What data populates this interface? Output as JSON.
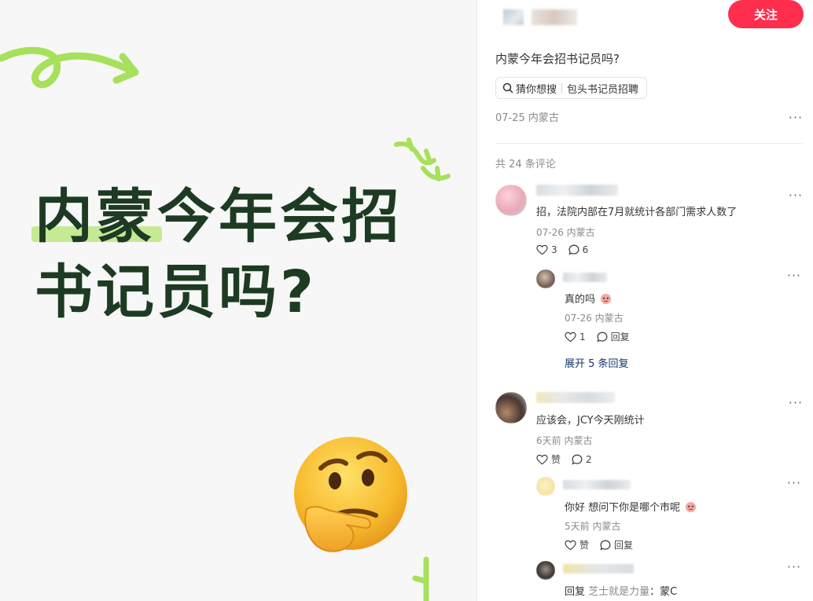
{
  "note": {
    "headline_line1_highlight": "内蒙",
    "headline_line1_rest": "今年会招",
    "headline_line2": "书记员吗?",
    "emoji": "thinking-face"
  },
  "panel": {
    "follow_label": "关注",
    "title": "内蒙今年会招书记员吗?",
    "search_chip": {
      "prefix": "猜你想搜",
      "query": "包头书记员招聘"
    },
    "meta": "07-25 内蒙古",
    "comment_count": "共 24 条评论",
    "colors": {
      "follow_bg": "#ff2e4d",
      "expand_link": "#13386c",
      "headline": "#1d3b22",
      "highlight": "#b6e673"
    }
  },
  "comments": [
    {
      "text": "招，法院内部在7月就统计各部门需求人数了",
      "meta": "07-26 内蒙古",
      "likes": "3",
      "replies": "6",
      "reply": {
        "text": "真的吗",
        "meta": "07-26 内蒙古",
        "likes": "1",
        "reply_label": "回复"
      },
      "expand_label": "展开 5 条回复"
    },
    {
      "text": "应该会，JCY今天刚统计",
      "meta": "6天前 内蒙古",
      "likes": "赞",
      "replies": "2",
      "reply": {
        "text": "你好 想问下你是哪个市呢",
        "meta": "5天前 内蒙古",
        "likes": "赞",
        "reply_label": "回复"
      },
      "reply2": {
        "prefix": "回复",
        "name": "芝士就是力量",
        "text": "：蒙C"
      }
    }
  ]
}
